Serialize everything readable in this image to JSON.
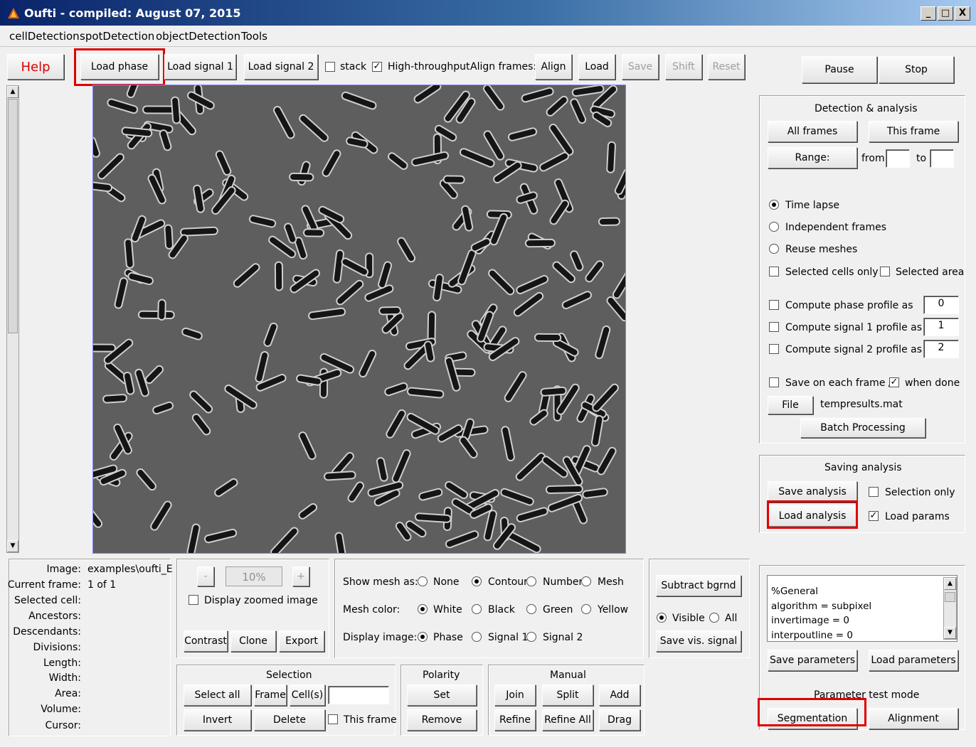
{
  "window": {
    "title": "Oufti - compiled:  August 07, 2015",
    "min": "_",
    "max": "□",
    "close": "X"
  },
  "menu": [
    "cellDetection",
    "spotDetection",
    "objectDetection",
    "Tools"
  ],
  "toolbar": {
    "help": "Help",
    "load_phase": "Load phase",
    "load_signal1": "Load signal 1",
    "load_signal2": "Load signal 2",
    "stack": "stack",
    "high_throughput": "High-throughput",
    "align_frames": "Align frames:",
    "align": "Align",
    "load": "Load",
    "save": "Save",
    "shift": "Shift",
    "reset": "Reset",
    "pause": "Pause",
    "stop": "Stop"
  },
  "detection": {
    "title": "Detection & analysis",
    "all_frames": "All frames",
    "this_frame": "This frame",
    "range": "Range:",
    "from": "from",
    "to": "to",
    "time_lapse": "Time lapse",
    "independent_frames": "Independent frames",
    "reuse_meshes": "Reuse meshes",
    "selected_cells_only": "Selected cells only",
    "selected_area": "Selected area",
    "compute_phase": "Compute phase profile as",
    "compute_sig1": "Compute signal 1 profile as",
    "compute_sig2": "Compute signal 2 profile as",
    "phase_val": "0",
    "sig1_val": "1",
    "sig2_val": "2",
    "save_each": "Save on each frame /",
    "when_done": "when done",
    "file": "File",
    "filename": "tempresults.mat",
    "batch": "Batch Processing"
  },
  "saving": {
    "title": "Saving analysis",
    "save_analysis": "Save analysis",
    "load_analysis": "Load analysis",
    "selection_only": "Selection only",
    "load_params": "Load params"
  },
  "params": {
    "lines": [
      "%General",
      "algorithm = subpixel",
      "invertimage = 0",
      "interpoutline = 0"
    ],
    "save_parameters": "Save parameters",
    "load_parameters": "Load parameters",
    "test_mode": "Parameter test mode",
    "segmentation": "Segmentation",
    "alignment": "Alignment"
  },
  "info": {
    "labels": [
      "Image:",
      "Current frame:",
      "Selected cell:",
      "Ancestors:",
      "Descendants:",
      "Divisions:",
      "Length:",
      "Width:",
      "Area:",
      "Volume:",
      "Cursor:"
    ],
    "image_val": "examples\\oufti_E",
    "frame_val": "1 of 1"
  },
  "zoom": {
    "minus": "-",
    "value": "10%",
    "plus": "+",
    "display_zoomed": "Display zoomed image",
    "contrast": "Contrast",
    "clone": "Clone",
    "export": "Export"
  },
  "display": {
    "show_mesh": "Show mesh as:",
    "none": "None",
    "contour": "Contour",
    "number": "Number",
    "mesh": "Mesh",
    "mesh_color": "Mesh color:",
    "white": "White",
    "black": "Black",
    "green": "Green",
    "yellow": "Yellow",
    "display_image": "Display image:",
    "phase": "Phase",
    "signal1": "Signal 1",
    "signal2": "Signal 2"
  },
  "bgrnd": {
    "subtract": "Subtract bgrnd",
    "visible": "Visible",
    "all": "All",
    "save_vis": "Save vis. signal"
  },
  "selection": {
    "title": "Selection",
    "select_all": "Select all",
    "frame": "Frame",
    "cells": "Cell(s)",
    "invert": "Invert",
    "delete": "Delete",
    "this_frame": "This frame"
  },
  "polarity": {
    "title": "Polarity",
    "set": "Set",
    "remove": "Remove"
  },
  "manual": {
    "title": "Manual",
    "join": "Join",
    "split": "Split",
    "add": "Add",
    "refine": "Refine",
    "refine_all": "Refine All",
    "drag": "Drag"
  }
}
